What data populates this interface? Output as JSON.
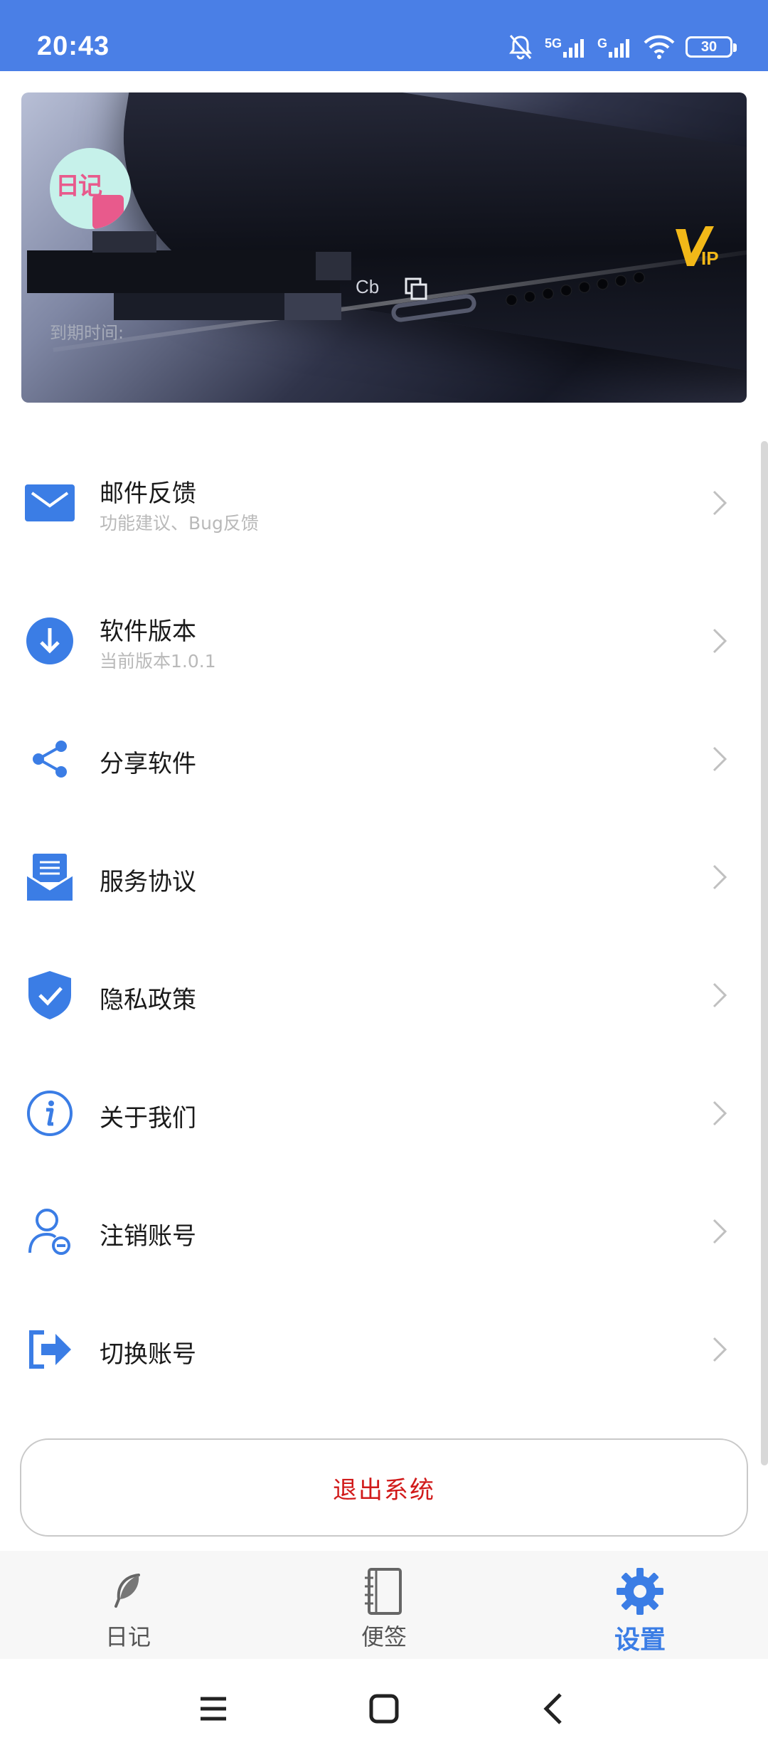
{
  "status_bar": {
    "time": "20:43",
    "battery": "30",
    "signal_1": "5G",
    "signal_2": "G"
  },
  "profile": {
    "avatar_text": "日记",
    "user_id_fragment": "Cb",
    "expire_label": "到期时间:",
    "vip_label": "VIP"
  },
  "menu": [
    {
      "title": "邮件反馈",
      "subtitle": "功能建议、Bug反馈",
      "icon": "mail-icon"
    },
    {
      "title": "软件版本",
      "subtitle": "当前版本1.0.1",
      "icon": "download-icon"
    },
    {
      "title": "分享软件",
      "subtitle": "",
      "icon": "share-icon"
    },
    {
      "title": "服务协议",
      "subtitle": "",
      "icon": "document-icon"
    },
    {
      "title": "隐私政策",
      "subtitle": "",
      "icon": "shield-check-icon"
    },
    {
      "title": "关于我们",
      "subtitle": "",
      "icon": "info-icon"
    },
    {
      "title": "注销账号",
      "subtitle": "",
      "icon": "user-remove-icon"
    },
    {
      "title": "切换账号",
      "subtitle": "",
      "icon": "switch-account-icon"
    }
  ],
  "logout": {
    "label": "退出系统"
  },
  "tabs": [
    {
      "label": "日记",
      "icon": "feather-icon",
      "active": false
    },
    {
      "label": "便签",
      "icon": "notebook-icon",
      "active": false
    },
    {
      "label": "设置",
      "icon": "gear-icon",
      "active": true
    }
  ],
  "colors": {
    "accent": "#3b7de5",
    "status_bar": "#4a7fe6",
    "logout_text": "#d11a1a"
  }
}
